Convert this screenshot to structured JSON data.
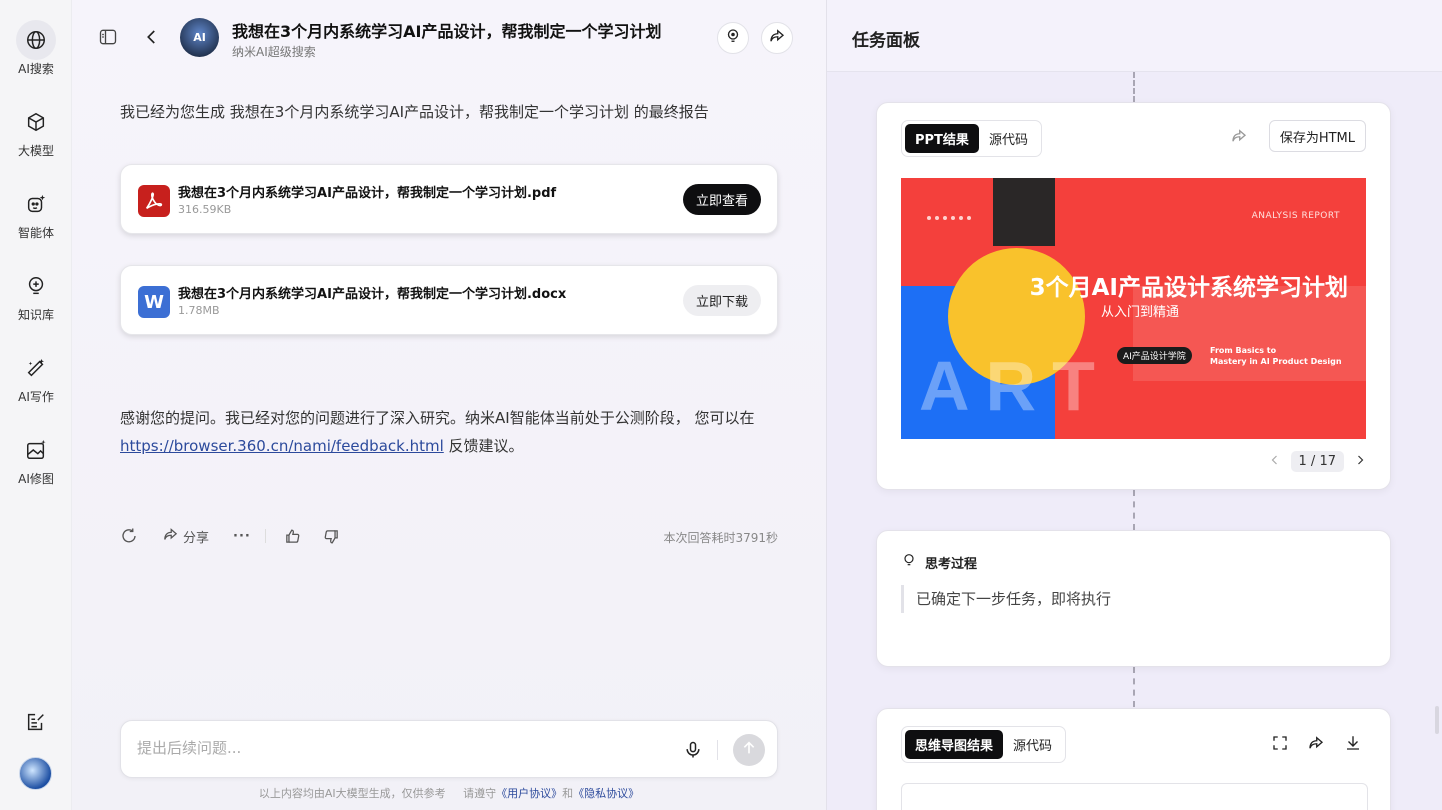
{
  "nav": {
    "items": [
      {
        "label": "AI搜索",
        "icon": "globe-icon"
      },
      {
        "label": "大模型",
        "icon": "cube-icon"
      },
      {
        "label": "智能体",
        "icon": "agent-icon"
      },
      {
        "label": "知识库",
        "icon": "bulb-icon"
      },
      {
        "label": "AI写作",
        "icon": "pen-sparkle-icon"
      },
      {
        "label": "AI修图",
        "icon": "image-edit-icon"
      }
    ]
  },
  "chat": {
    "title": "我想在3个月内系统学习AI产品设计，帮我制定一个学习计划",
    "subtitle": "纳米AI超级搜索",
    "avatar_text": "AI",
    "intro": "我已经为您生成 我想在3个月内系统学习AI产品设计，帮我制定一个学习计划 的最终报告",
    "files": [
      {
        "name": "我想在3个月内系统学习AI产品设计，帮我制定一个学习计划.pdf",
        "size": "316.59KB",
        "button": "立即查看",
        "type": "pdf"
      },
      {
        "name": "我想在3个月内系统学习AI产品设计，帮我制定一个学习计划.docx",
        "size": "1.78MB",
        "button": "立即下载",
        "type": "docx",
        "icon_letter": "W"
      }
    ],
    "thanks_before": "感谢您的提问。我已经对您的问题进行了深入研究。纳米AI智能体当前处于公测阶段， 您可以在 ",
    "thanks_link": "https://browser.360.cn/nami/feedback.html",
    "thanks_after": " 反馈建议。",
    "actions": {
      "share": "分享",
      "more": "···"
    },
    "elapsed": "本次回答耗时3791秒",
    "input_placeholder": "提出后续问题...",
    "footer": {
      "prefix": "以上内容均由AI大模型生成，仅供参考",
      "middle": "请遵守",
      "user_agreement": "《用户协议》",
      "and": "和",
      "privacy": "《隐私协议》"
    }
  },
  "panel": {
    "title": "任务面板",
    "ppt_card": {
      "tabs": [
        "PPT结果",
        "源代码"
      ],
      "active_tab": "PPT结果",
      "save_label": "保存为HTML",
      "slide": {
        "report_label": "ANALYSIS  REPORT",
        "title": "3个月AI产品设计系统学习计划",
        "subtitle": "从入门到精通",
        "pill": "AI产品设计学院",
        "english_line1": "From Basics to",
        "english_line2": "Mastery in AI Product Design",
        "watermark": "ART"
      },
      "pager": {
        "current": "1 / 17"
      }
    },
    "think_card": {
      "heading": "思考过程",
      "body": "已确定下一步任务，即将执行"
    },
    "mind_card": {
      "tabs": [
        "思维导图结果",
        "源代码"
      ],
      "active_tab": "思维导图结果"
    }
  },
  "colors": {
    "accent_dark": "#0e0e10",
    "slide_red": "#f4403c",
    "slide_blue": "#1d6ff5",
    "slide_yellow": "#f9c22c",
    "link": "#2c4a9c"
  }
}
